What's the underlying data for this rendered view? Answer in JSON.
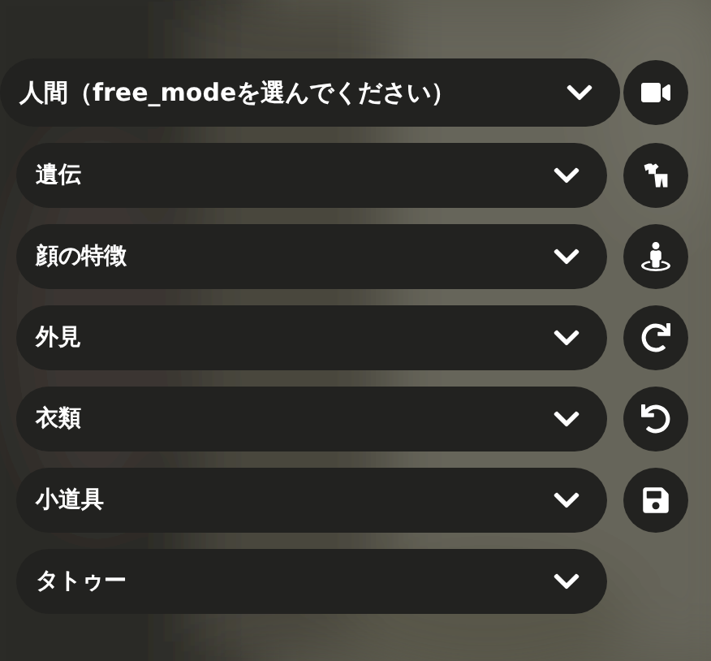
{
  "dropdowns": [
    {
      "kind": "header",
      "label": "人間（free_modeを選んでください）"
    },
    {
      "kind": "section",
      "label": "遺伝"
    },
    {
      "kind": "section",
      "label": "顔の特徴"
    },
    {
      "kind": "section",
      "label": "外見"
    },
    {
      "kind": "section",
      "label": "衣類"
    },
    {
      "kind": "section",
      "label": "小道具"
    },
    {
      "kind": "section",
      "label": "タトゥー"
    }
  ],
  "tools": [
    {
      "kind": "camera"
    },
    {
      "kind": "clothes"
    },
    {
      "kind": "pose"
    },
    {
      "kind": "redo"
    },
    {
      "kind": "undo"
    },
    {
      "kind": "save"
    }
  ]
}
